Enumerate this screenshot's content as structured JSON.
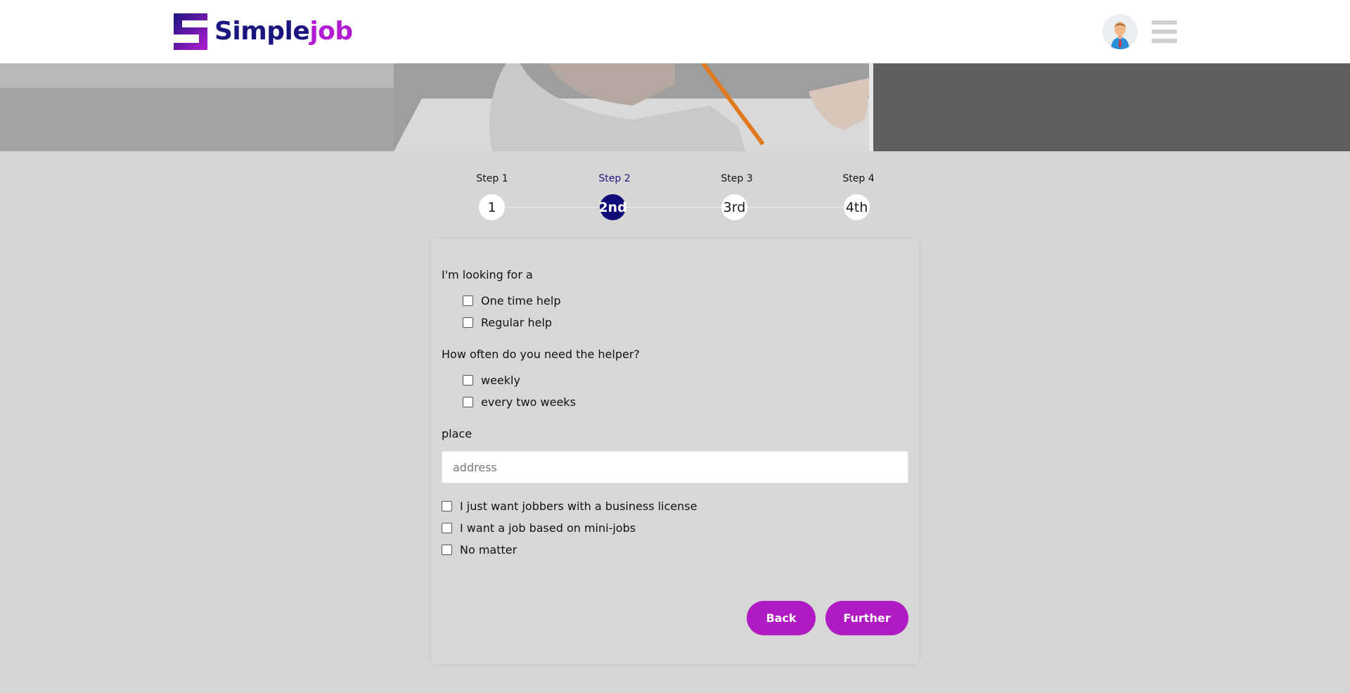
{
  "header": {
    "logo_part1": "Simple",
    "logo_part2": "job",
    "brand_colors": {
      "primary": "#1b1580",
      "accent": "#b21bd1"
    }
  },
  "steps": [
    {
      "label": "Step 1",
      "value": "1",
      "active": false
    },
    {
      "label": "Step 2",
      "value": "2nd",
      "active": true
    },
    {
      "label": "Step 3",
      "value": "3rd",
      "active": false
    },
    {
      "label": "Step 4",
      "value": "4th",
      "active": false
    }
  ],
  "form": {
    "q1": "I'm looking for a",
    "q1_options": [
      "One time help",
      "Regular help"
    ],
    "q2": "How often do you need the helper?",
    "q2_options": [
      "weekly",
      "every two weeks"
    ],
    "place_label": "place",
    "address_placeholder": "address",
    "extra_options": [
      "I just want jobbers with a business license",
      "I want a job based on mini-jobs",
      "No matter"
    ],
    "back_label": "Back",
    "further_label": "Further",
    "button_color": "#b01ac3"
  }
}
